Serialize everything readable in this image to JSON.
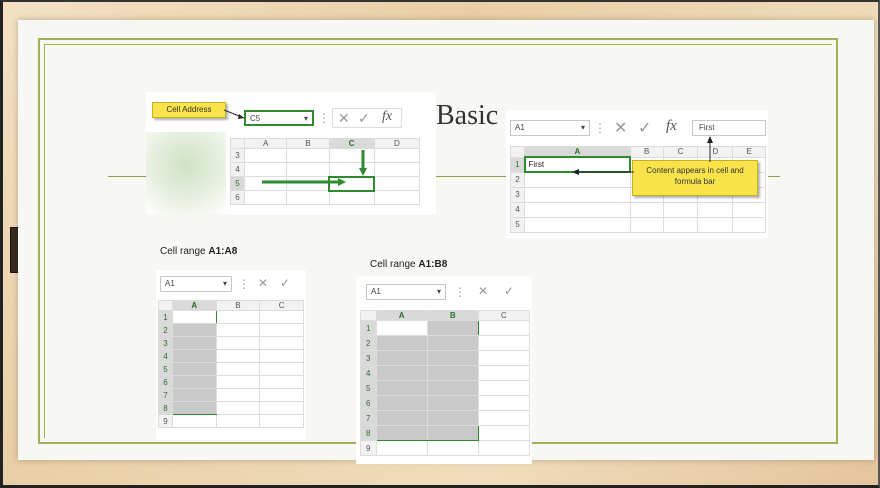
{
  "slide": {
    "title": "Basic"
  },
  "panel_address": {
    "callout": "Cell Address",
    "namebox": "C5",
    "columns": [
      "A",
      "B",
      "C",
      "D"
    ],
    "rows": [
      "3",
      "4",
      "5",
      "6"
    ]
  },
  "panel_content": {
    "namebox": "A1",
    "formula_value": "First",
    "columns": [
      "A",
      "B",
      "C",
      "D",
      "E"
    ],
    "rows": [
      "1",
      "2",
      "3",
      "4",
      "5"
    ],
    "cell_a1": "First",
    "callout": "Content appears in cell and formula bar"
  },
  "range_a": {
    "caption_prefix": "Cell range ",
    "caption_range": "A1:A8",
    "namebox": "A1",
    "columns": [
      "A",
      "B",
      "C"
    ],
    "rows": [
      "1",
      "2",
      "3",
      "4",
      "5",
      "6",
      "7",
      "8",
      "9"
    ]
  },
  "range_b": {
    "caption_prefix": "Cell range ",
    "caption_range": "A1:B8",
    "namebox": "A1",
    "columns": [
      "A",
      "B",
      "C"
    ],
    "rows": [
      "1",
      "2",
      "3",
      "4",
      "5",
      "6",
      "7",
      "8",
      "9"
    ]
  },
  "icons": {
    "cancel": "✕",
    "enter": "✓",
    "function": "fx",
    "dropdown": "▾",
    "dots": "⋮"
  }
}
